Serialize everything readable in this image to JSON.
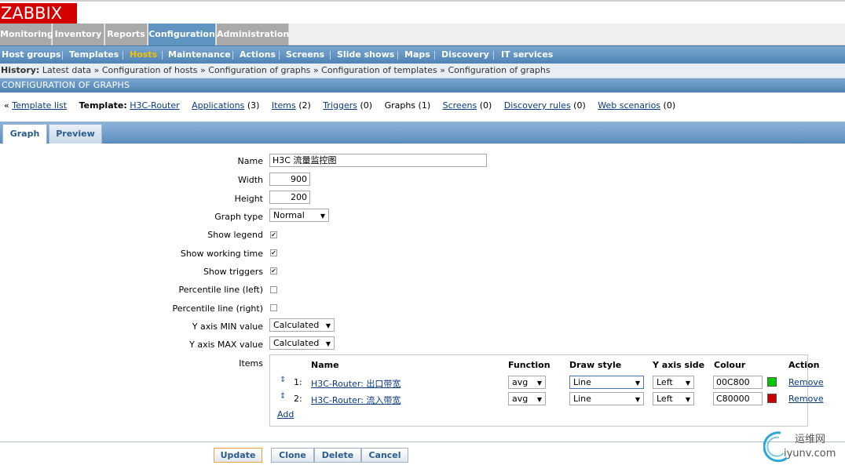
{
  "logo": "ZABBIX",
  "main_menu": [
    "Monitoring",
    "Inventory",
    "Reports",
    "Configuration",
    "Administration"
  ],
  "sub_menu": [
    "Host groups",
    "Templates",
    "Hosts",
    "Maintenance",
    "Actions",
    "Screens",
    "Slide shows",
    "Maps",
    "Discovery",
    "IT services"
  ],
  "history": {
    "label": "History:",
    "items": [
      "Latest data",
      "Configuration of hosts",
      "Configuration of graphs",
      "Configuration of templates",
      "Configuration of graphs"
    ],
    "separator": "»"
  },
  "page_header": "CONFIGURATION OF GRAPHS",
  "template_nav": {
    "back": "«",
    "template_list": "Template list",
    "template_label": "Template:",
    "template_name": "H3C-Router",
    "applications": "Applications",
    "applications_count": "(3)",
    "items": "Items",
    "items_count": "(2)",
    "triggers": "Triggers",
    "triggers_count": "(0)",
    "graphs": "Graphs (1)",
    "screens": "Screens",
    "screens_count": "(0)",
    "discovery": "Discovery rules",
    "discovery_count": "(0)",
    "web": "Web scenarios",
    "web_count": "(0)"
  },
  "tabs": [
    "Graph",
    "Preview"
  ],
  "form": {
    "name_label": "Name",
    "name_value": "H3C 流量监控图",
    "width_label": "Width",
    "width_value": "900",
    "height_label": "Height",
    "height_value": "200",
    "graph_type_label": "Graph type",
    "graph_type_value": "Normal",
    "show_legend_label": "Show legend",
    "show_working_time_label": "Show working time",
    "show_triggers_label": "Show triggers",
    "percentile_left_label": "Percentile line (left)",
    "percentile_right_label": "Percentile line (right)",
    "ymin_label": "Y axis MIN value",
    "ymin_value": "Calculated",
    "ymax_label": "Y axis MAX value",
    "ymax_value": "Calculated",
    "items_label": "Items",
    "check_mark": "✔"
  },
  "items_table": {
    "headers": [
      "Name",
      "Function",
      "Draw style",
      "Y axis side",
      "Colour",
      "Action"
    ],
    "rows": [
      {
        "num": "1:",
        "name": "H3C-Router: 出口带宽",
        "function": "avg",
        "draw_style": "Line",
        "y_side": "Left",
        "colour": "00C800",
        "colour_hex": "#00c800",
        "action": "Remove"
      },
      {
        "num": "2:",
        "name": "H3C-Router: 流入带宽",
        "function": "avg",
        "draw_style": "Line",
        "y_side": "Left",
        "colour": "C80000",
        "colour_hex": "#c80000",
        "action": "Remove"
      }
    ],
    "add": "Add"
  },
  "buttons": [
    "Update",
    "Clone",
    "Delete",
    "Cancel"
  ],
  "watermark": {
    "top": "运维网",
    "bottom": "iyunv.com"
  }
}
